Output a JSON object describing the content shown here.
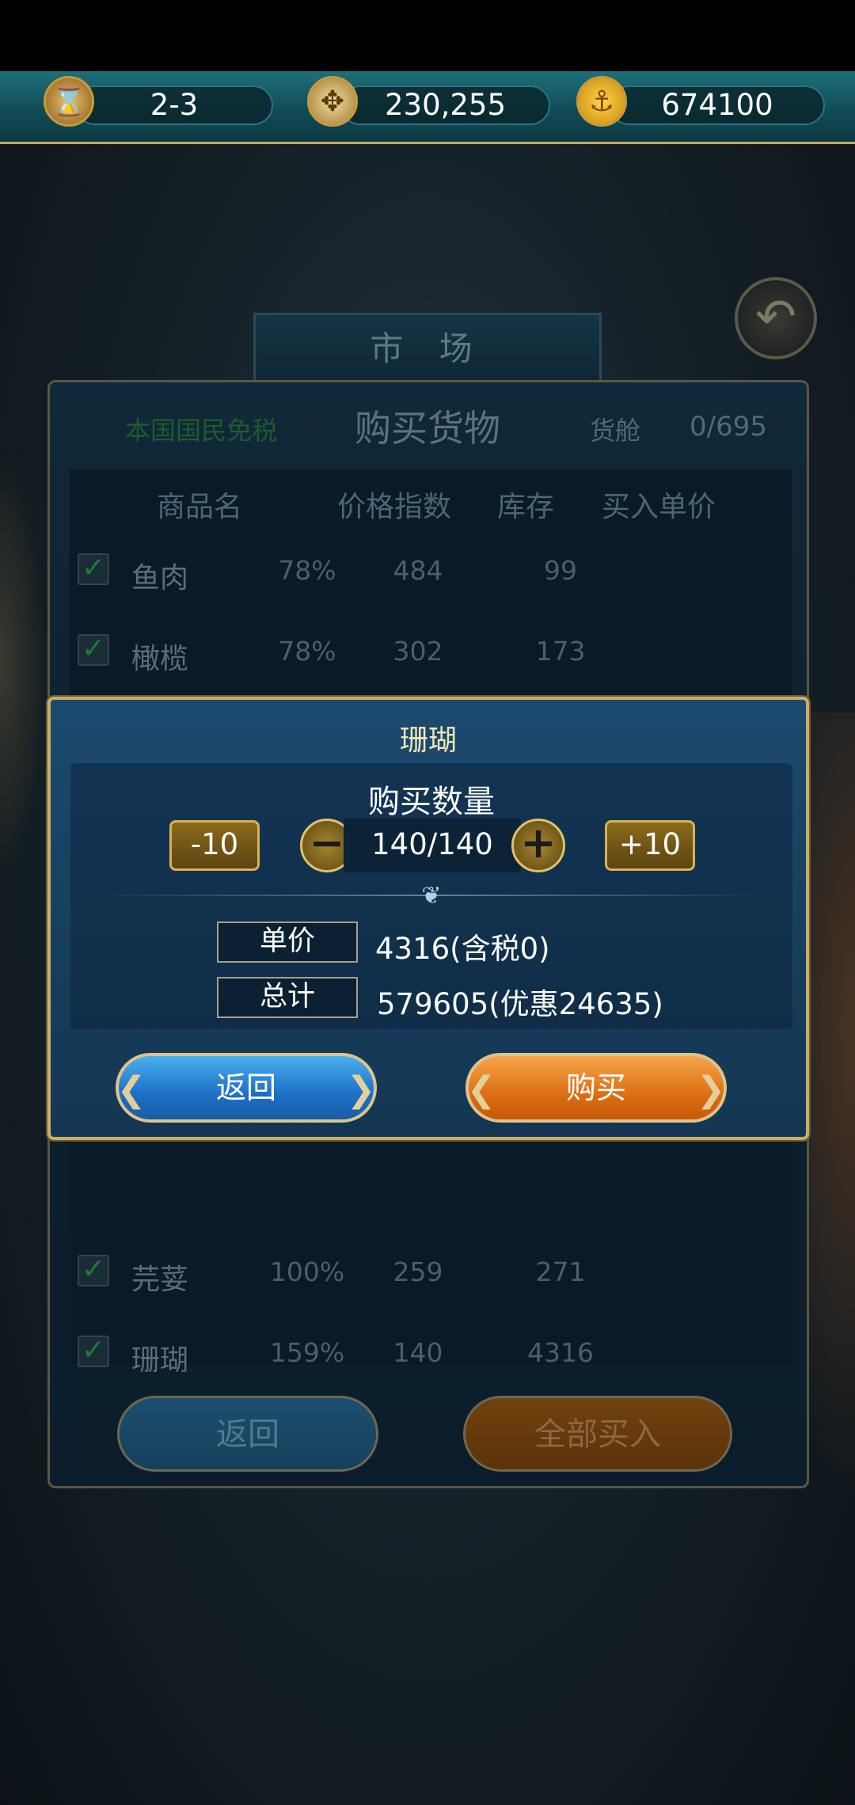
{
  "resources": [
    {
      "icon": "hourglass-icon",
      "glyph": "⌛",
      "value": "2-3"
    },
    {
      "icon": "compass-icon",
      "glyph": "✥",
      "value": "230,255"
    },
    {
      "icon": "anchor-coin-icon",
      "glyph": "⚓",
      "value": "674100"
    }
  ],
  "market": {
    "title": "市 场",
    "back_glyph": "↶"
  },
  "panel": {
    "tax_note": "本国国民免税",
    "title": "购买货物",
    "hold_label": "货舱",
    "hold_value": "0/695",
    "columns": [
      "商品名",
      "价格指数",
      "库存",
      "买入单价"
    ],
    "rows": [
      {
        "name": "鱼肉",
        "index": "78%",
        "stock": "484",
        "price": "99"
      },
      {
        "name": "橄榄",
        "index": "78%",
        "stock": "302",
        "price": "173"
      },
      {
        "name": "芫荽",
        "index": "100%",
        "stock": "259",
        "price": "271"
      },
      {
        "name": "珊瑚",
        "index": "159%",
        "stock": "140",
        "price": "4316"
      }
    ],
    "check_glyph": "✓",
    "back_label": "返回",
    "buy_all_label": "全部买入"
  },
  "dialog": {
    "title": "珊瑚",
    "qty_label": "购买数量",
    "minus10": "-10",
    "plus10": "+10",
    "minus_glyph": "−",
    "plus_glyph": "+",
    "qty_value": "140/140",
    "unit_price_label": "单价",
    "unit_price_value": "4316(含税0)",
    "total_label": "总计",
    "total_value": "579605(优惠24635)",
    "back_label": "返回",
    "buy_label": "购买",
    "ornament": "❦"
  }
}
